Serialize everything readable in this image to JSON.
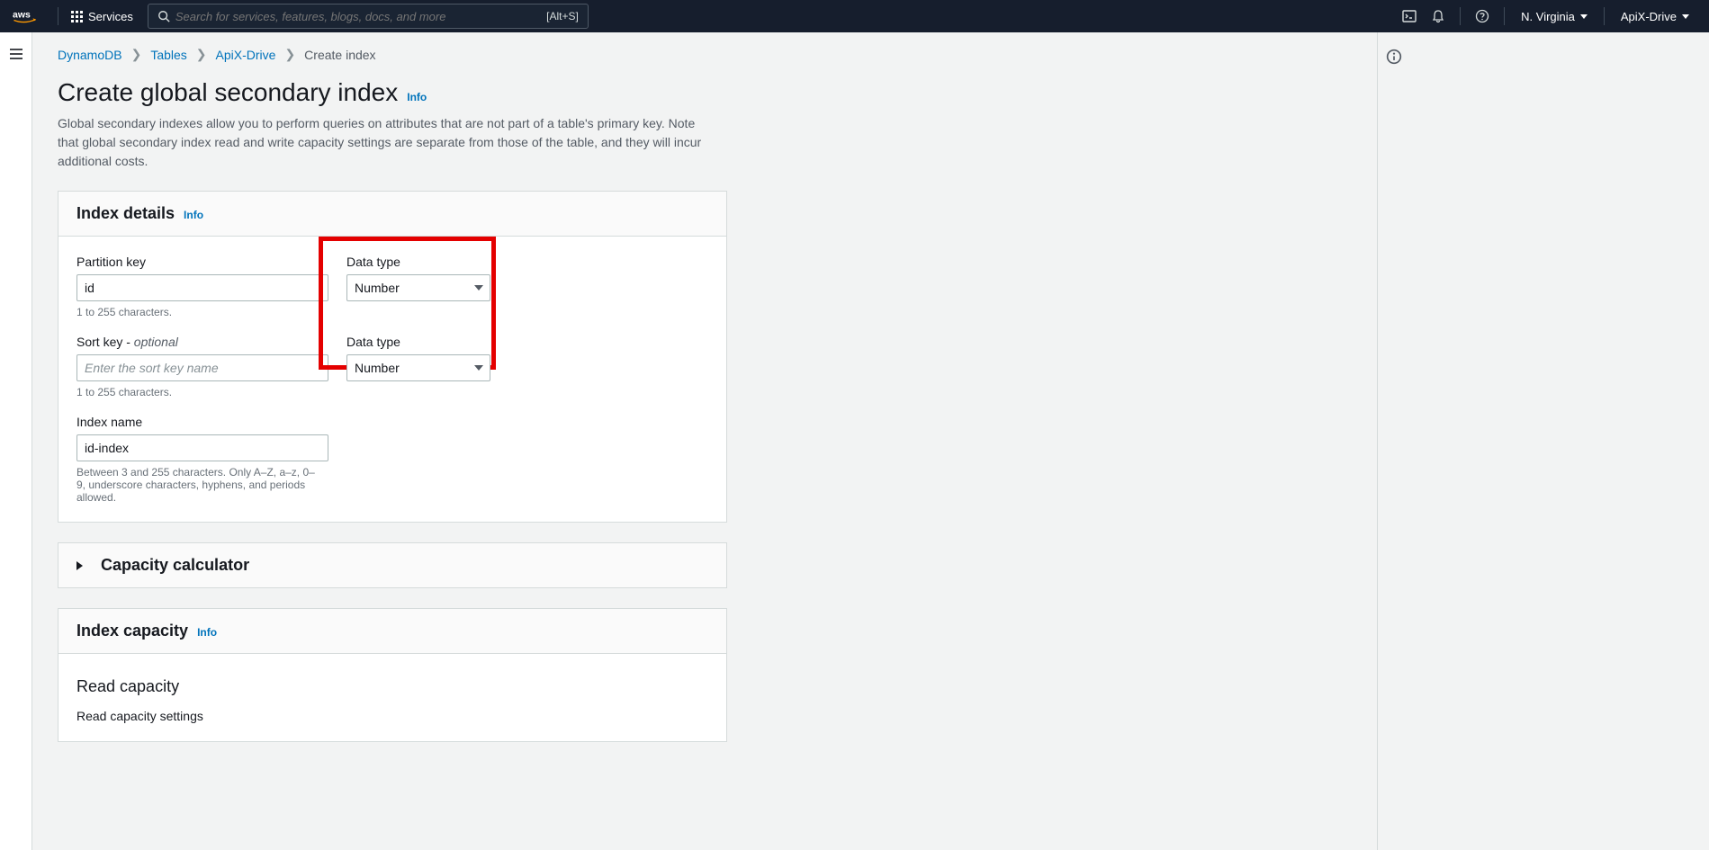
{
  "nav": {
    "services": "Services",
    "search_placeholder": "Search for services, features, blogs, docs, and more",
    "search_shortcut": "[Alt+S]",
    "region": "N. Virginia",
    "account": "ApiX-Drive"
  },
  "breadcrumb": {
    "items": [
      "DynamoDB",
      "Tables",
      "ApiX-Drive"
    ],
    "current": "Create index"
  },
  "header": {
    "title": "Create global secondary index",
    "info": "Info",
    "desc": "Global secondary indexes allow you to perform queries on attributes that are not part of a table's primary key. Note that global secondary index read and write capacity settings are separate from those of the table, and they will incur additional costs."
  },
  "index_details": {
    "title": "Index details",
    "info": "Info",
    "partition_key_label": "Partition key",
    "partition_key_value": "id",
    "partition_key_helper": "1 to 255 characters.",
    "data_type_label": "Data type",
    "partition_data_type_value": "Number",
    "sort_key_label": "Sort key - ",
    "sort_key_optional": "optional",
    "sort_key_placeholder": "Enter the sort key name",
    "sort_key_helper": "1 to 255 characters.",
    "sort_data_type_value": "Number",
    "index_name_label": "Index name",
    "index_name_value": "id-index",
    "index_name_helper": "Between 3 and 255 characters. Only A–Z, a–z, 0–9, underscore characters, hyphens, and periods allowed."
  },
  "calculator": {
    "title": "Capacity calculator"
  },
  "capacity": {
    "title": "Index capacity",
    "info": "Info",
    "read_capacity": "Read capacity",
    "read_capacity_settings": "Read capacity settings"
  }
}
